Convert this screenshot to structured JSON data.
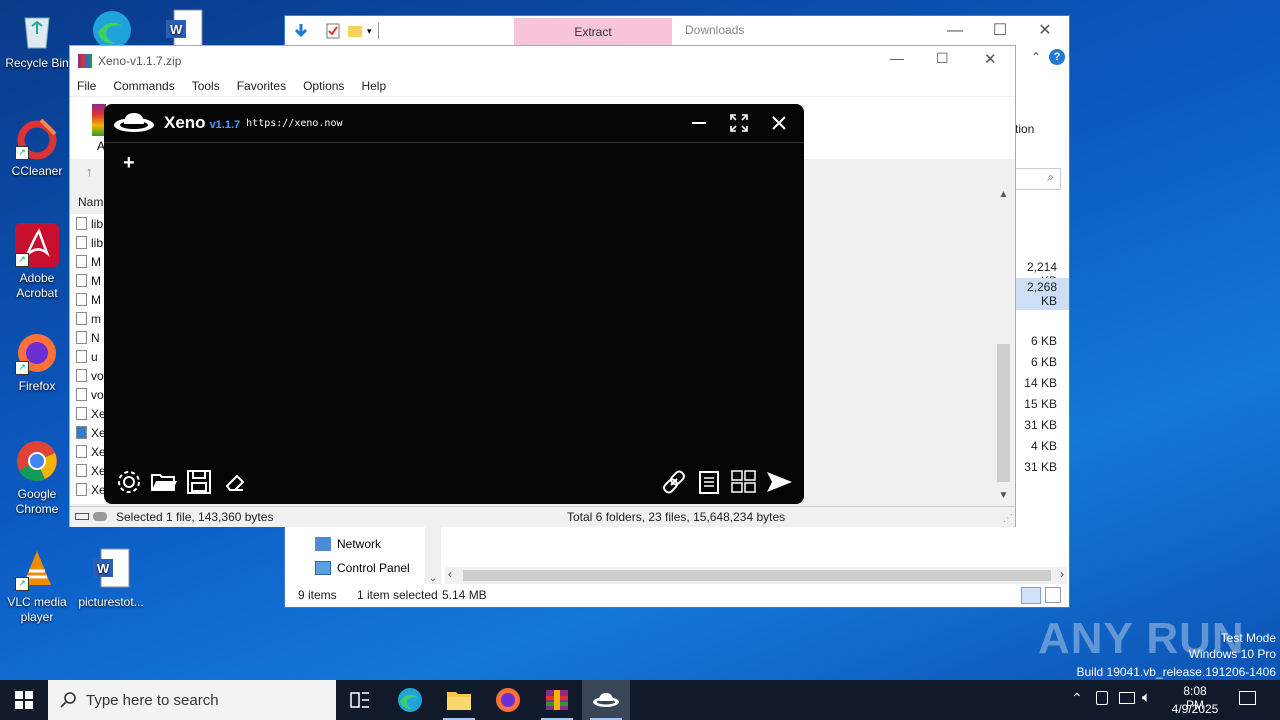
{
  "desktop": {
    "icons": [
      {
        "label": "Recycle Bin",
        "icon": "recycle-bin-icon"
      },
      {
        "label": "CCleaner",
        "icon": "ccleaner-icon"
      },
      {
        "label": "Adobe Acrobat",
        "icon": "adobe-acrobat-icon"
      },
      {
        "label": "Firefox",
        "icon": "firefox-icon"
      },
      {
        "label": "Google Chrome",
        "icon": "chrome-icon"
      },
      {
        "label": "VLC media player",
        "icon": "vlc-icon"
      },
      {
        "label": "picturestot...",
        "icon": "word-doc-icon"
      }
    ]
  },
  "explorer": {
    "tab_extract": "Extract",
    "tab_downloads": "Downloads",
    "ribbon_fragment": "tion",
    "sizes": [
      "2,214 KB",
      "2,268 KB",
      "6 KB",
      "6 KB",
      "14 KB",
      "15 KB",
      "31 KB",
      "4 KB",
      "31 KB"
    ],
    "nav_items": [
      "Network",
      "Control Panel"
    ],
    "status_items": "9 items",
    "status_selected": "1 item selected",
    "status_size": "5.14 MB"
  },
  "winrar": {
    "title": "Xeno-v1.1.7.zip",
    "menu": [
      "File",
      "Commands",
      "Tools",
      "Favorites",
      "Options",
      "Help"
    ],
    "toolbar_fragment": "A",
    "column_name": "Nam",
    "file_rows": [
      "lib",
      "lib",
      "M",
      "M",
      "M",
      "m",
      "N",
      "u",
      "vo",
      "vo",
      "Xe",
      "Xe",
      "Xe",
      "Xe",
      "Xe"
    ],
    "status_left": "Selected 1 file, 143,360 bytes",
    "status_right": "Total 6 folders, 23 files, 15,648,234 bytes"
  },
  "xeno": {
    "name": "Xeno",
    "version": "v1.1.7",
    "url": "https://xeno.now",
    "add_tab": "+"
  },
  "taskbar": {
    "search_placeholder": "Type here to search",
    "time": "8:08 PM",
    "date": "4/9/2025"
  },
  "watermark": {
    "brand": "ANY RUN",
    "mode": "Test Mode",
    "os": "Windows 10 Pro",
    "build": "Build 19041.vb_release.191206-1406"
  },
  "colors": {
    "xeno_accent": "#4aa3ff",
    "extract_tab": "#f8c4dc",
    "taskbar": "#111a2b"
  }
}
